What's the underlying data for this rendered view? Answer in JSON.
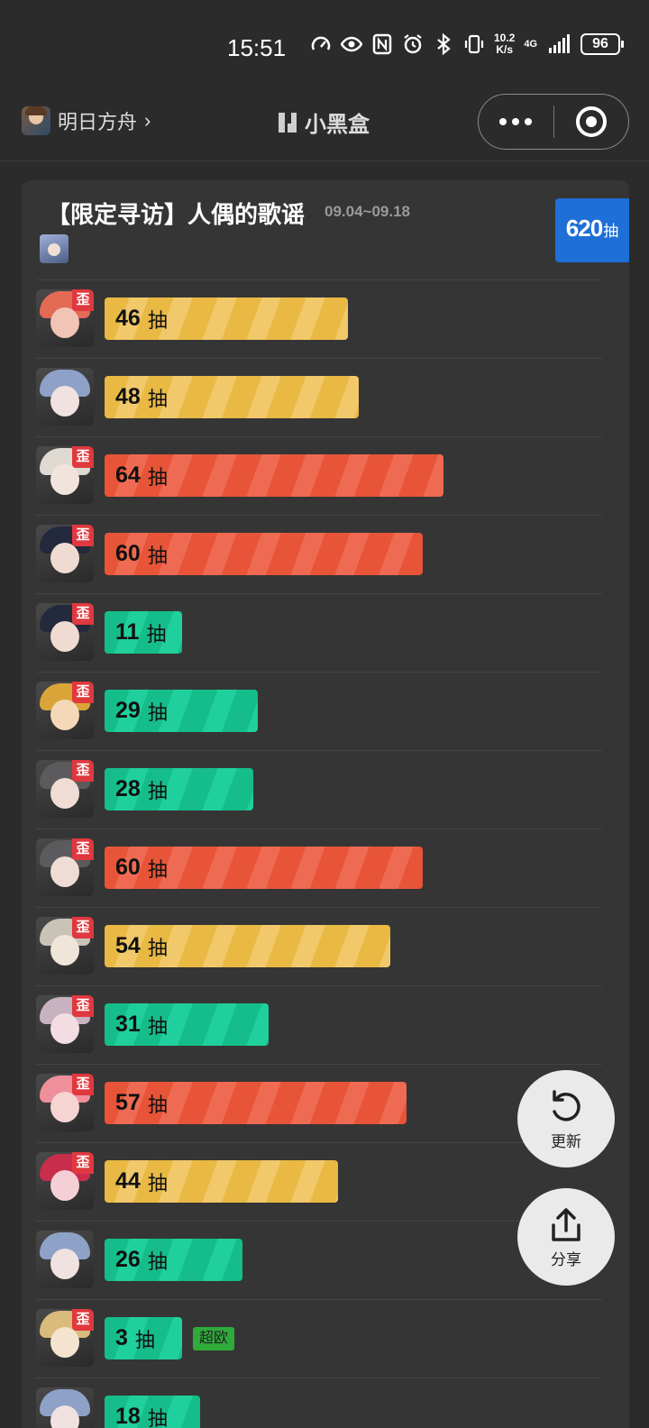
{
  "status_bar": {
    "time": "15:51",
    "net_speed_top": "10.2",
    "net_speed_bottom": "K/s",
    "net_type": "4G",
    "battery": "96",
    "icons": [
      "speedometer-icon",
      "eye-icon",
      "nfc-icon",
      "alarm-icon",
      "bluetooth-icon",
      "vibrate-icon",
      "signal-icon"
    ]
  },
  "header": {
    "game_name": "明日方舟",
    "chevron": "›",
    "brand_name": "小黑盒",
    "more_icon": "more-dots-icon",
    "close_icon": "target-close-icon"
  },
  "card": {
    "title": "【限定寻访】人偶的歌谣",
    "date_range": "09.04~09.18",
    "total_value": "620",
    "total_unit": "抽",
    "unit": "抽",
    "wai_label": "歪",
    "lucky_label": "超欧",
    "max_pulls": 80,
    "colors": {
      "yellow": "#e9b944",
      "red": "#e85438",
      "green": "#15bd8a",
      "badge_blue": "#1e6fd6",
      "wai_red": "#e0383e"
    },
    "rows": [
      {
        "pulls": "46",
        "color": "yellow",
        "wai": true,
        "lucky": false
      },
      {
        "pulls": "48",
        "color": "yellow",
        "wai": false,
        "lucky": false
      },
      {
        "pulls": "64",
        "color": "red",
        "wai": true,
        "lucky": false
      },
      {
        "pulls": "60",
        "color": "red",
        "wai": true,
        "lucky": false
      },
      {
        "pulls": "11",
        "color": "green",
        "wai": true,
        "lucky": false
      },
      {
        "pulls": "29",
        "color": "green",
        "wai": true,
        "lucky": false
      },
      {
        "pulls": "28",
        "color": "green",
        "wai": true,
        "lucky": false
      },
      {
        "pulls": "60",
        "color": "red",
        "wai": true,
        "lucky": false
      },
      {
        "pulls": "54",
        "color": "yellow",
        "wai": true,
        "lucky": false
      },
      {
        "pulls": "31",
        "color": "green",
        "wai": true,
        "lucky": false
      },
      {
        "pulls": "57",
        "color": "red",
        "wai": true,
        "lucky": false
      },
      {
        "pulls": "44",
        "color": "yellow",
        "wai": true,
        "lucky": false
      },
      {
        "pulls": "26",
        "color": "green",
        "wai": false,
        "lucky": false
      },
      {
        "pulls": "3",
        "color": "green",
        "wai": true,
        "lucky": true
      },
      {
        "pulls": "18",
        "color": "green",
        "wai": false,
        "lucky": false
      }
    ]
  },
  "actions": {
    "refresh_label": "更新",
    "share_label": "分享"
  }
}
